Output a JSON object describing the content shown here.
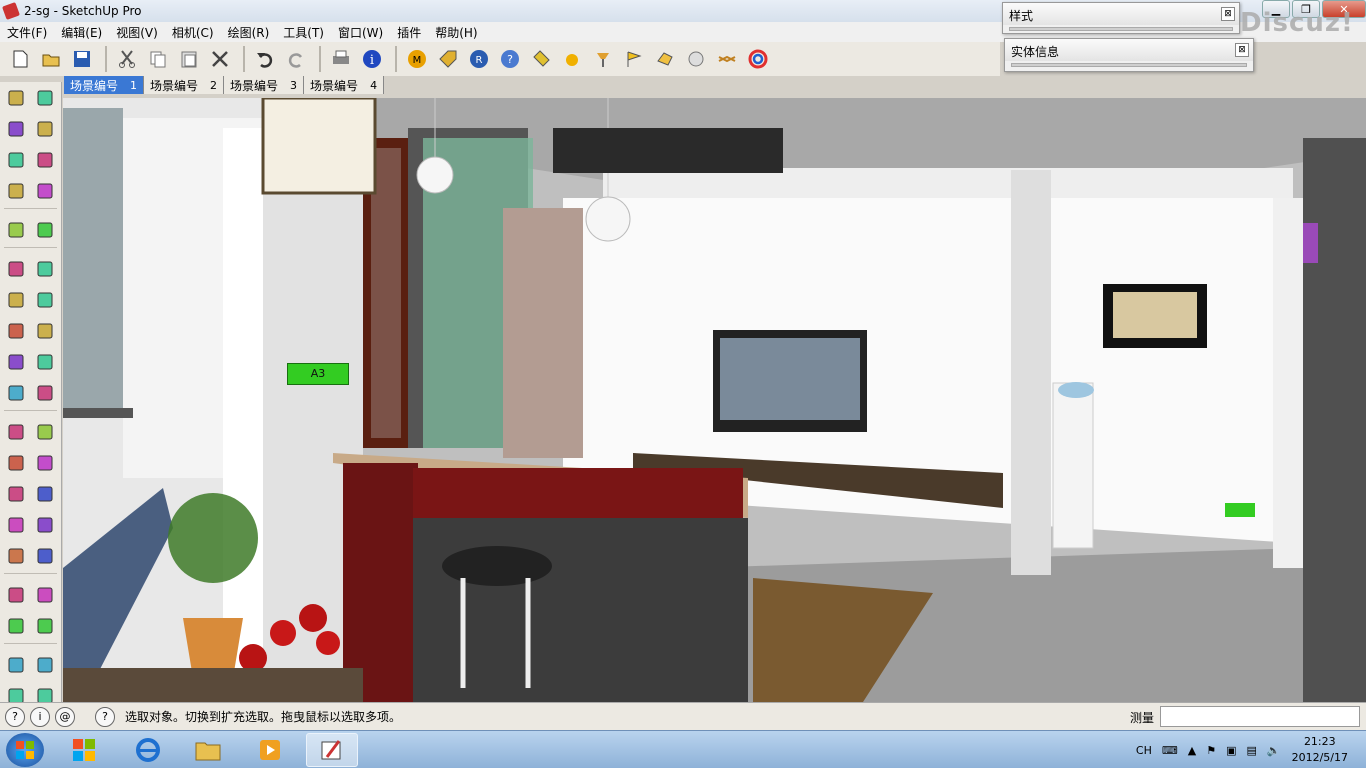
{
  "window": {
    "title": "2-sg - SketchUp Pro"
  },
  "menu": [
    "文件(F)",
    "编辑(E)",
    "视图(V)",
    "相机(C)",
    "绘图(R)",
    "工具(T)",
    "窗口(W)",
    "插件",
    "帮助(H)"
  ],
  "toolbar": {
    "icons": [
      "new-icon",
      "open-icon",
      "save-icon",
      "cut-icon",
      "copy-icon",
      "paste-icon",
      "erase-icon",
      "undo-icon",
      "redo-icon",
      "print-icon",
      "info-icon",
      "plugin-m-icon",
      "plugin-tag-icon",
      "plugin-r-icon",
      "help-icon",
      "tag-icon",
      "sphere-icon",
      "lamp-icon",
      "flag-icon",
      "hand-icon",
      "ball-icon",
      "link-icon",
      "swirl-icon"
    ]
  },
  "scenes": [
    {
      "label": "场景编号",
      "num": "1",
      "active": true
    },
    {
      "label": "场景编号",
      "num": "2",
      "active": false
    },
    {
      "label": "场景编号",
      "num": "3",
      "active": false
    },
    {
      "label": "场景编号",
      "num": "4",
      "active": false
    }
  ],
  "palette": [
    [
      "select-icon",
      "component-icon"
    ],
    [
      "paint-bucket-icon",
      "eraser-icon"
    ],
    [
      "rectangle-icon",
      "line-icon"
    ],
    [
      "circle-icon",
      "arc-icon"
    ],
    [
      "polygon-icon",
      "freehand-icon"
    ],
    [
      "move-icon",
      "push-pull-icon"
    ],
    [
      "rotate-icon",
      "follow-me-icon"
    ],
    [
      "scale-icon",
      "offset-icon"
    ],
    [
      "tape-measure-icon",
      "dimension-icon"
    ],
    [
      "protractor-icon",
      "text-icon"
    ],
    [
      "axes-icon",
      "3d-text-icon"
    ],
    [
      "orbit-icon",
      "pan-icon"
    ],
    [
      "zoom-icon",
      "zoom-window-icon"
    ],
    [
      "previous-view-icon",
      "zoom-extents-icon"
    ],
    [
      "position-camera-icon",
      "look-around-icon"
    ],
    [
      "walk-icon",
      "section-plane-icon"
    ],
    [
      "iso-view-icon",
      "top-view-icon"
    ],
    [
      "front-view-icon",
      "right-view-icon"
    ],
    [
      "back-view-icon",
      "left-view-icon"
    ]
  ],
  "panels": {
    "style": {
      "title": "样式"
    },
    "entity": {
      "title": "实体信息"
    }
  },
  "watermark": "Discuz!",
  "scene_labels": {
    "tag_a3": "A3"
  },
  "statusbar": {
    "text": "选取对象。切换到扩充选取。拖曳鼠标以选取多项。",
    "measure_label": "测量",
    "measure_value": ""
  },
  "taskbar": {
    "tray_lang": "CH",
    "time": "21:23",
    "date": "2012/5/17"
  },
  "colors": {
    "accent": "#3a78d4",
    "wall": "#ffffff",
    "floor": "#9a9a9a",
    "counter_red": "#7a1515",
    "green_label": "#33cc22"
  }
}
